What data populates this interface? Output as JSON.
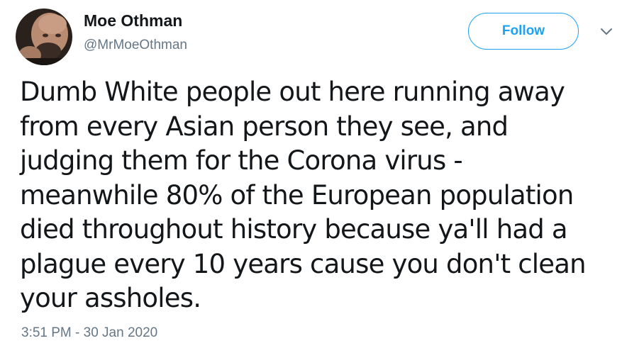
{
  "author": {
    "display_name": "Moe Othman",
    "handle": "@MrMoeOthman"
  },
  "actions": {
    "follow_label": "Follow",
    "menu_icon": "chevron-down-icon"
  },
  "tweet": {
    "text": "Dumb White people out here running away\nfrom every Asian person they see, and\njudging them for the Corona virus -\nmeanwhile 80% of the European population\ndied throughout history because ya'll had a\nplague every 10 years cause you don't clean\nyour assholes.",
    "timestamp": "3:51 PM - 30 Jan 2020"
  },
  "colors": {
    "accent": "#1da1f2",
    "text": "#14171a",
    "secondary_text": "#657786"
  }
}
